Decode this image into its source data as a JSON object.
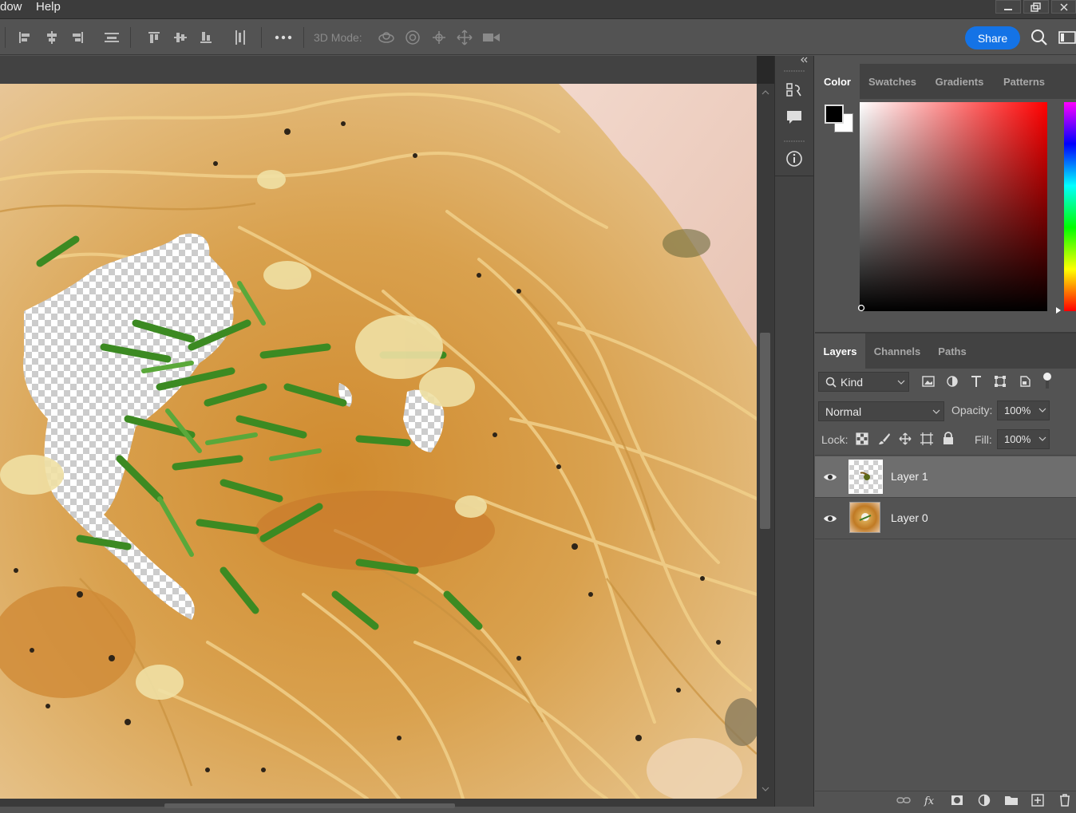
{
  "menu": {
    "items": [
      "dow",
      "Help"
    ]
  },
  "options_bar": {
    "mode3d_label": "3D Mode:",
    "share_label": "Share"
  },
  "icons": {
    "align": [
      "align-left-icon",
      "align-hcenter-icon",
      "align-right-icon",
      "distribute-icon",
      "align-top-icon",
      "align-vcenter-icon",
      "align-bottom-icon",
      "distribute-vertical-icon",
      "more-icon"
    ],
    "mode3d": [
      "orbit-3d-icon",
      "roll-3d-icon",
      "pan-3d-icon",
      "slide-3d-icon",
      "scale-3d-icon"
    ],
    "strip": [
      "history-icon",
      "comment-icon",
      "info-icon"
    ]
  },
  "color_panel": {
    "tabs": [
      "Color",
      "Swatches",
      "Gradients",
      "Patterns"
    ],
    "active_tab": "Color",
    "foreground": "#000000",
    "background": "#ffffff",
    "hue": "#ff0000"
  },
  "layers_panel": {
    "tabs": [
      "Layers",
      "Channels",
      "Paths"
    ],
    "active_tab": "Layers",
    "filter_label": "Kind",
    "blend_mode": "Normal",
    "opacity_label": "Opacity:",
    "opacity_value": "100%",
    "lock_label": "Lock:",
    "fill_label": "Fill:",
    "fill_value": "100%",
    "layers": [
      {
        "name": "Layer 1",
        "visible": true,
        "selected": true
      },
      {
        "name": "Layer 0",
        "visible": true,
        "selected": false
      }
    ]
  },
  "colors": {
    "accent": "#1473e6",
    "panel_bg": "#535353",
    "tab_bg": "#424242",
    "selected_layer": "#6e6e6e"
  }
}
